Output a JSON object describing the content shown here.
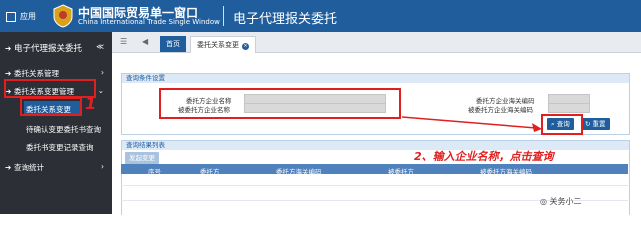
{
  "topbar": {
    "app_label": "应用",
    "brand_cn": "中国国际贸易单一窗口",
    "brand_en": "China International Trade Single Window",
    "title": "电子代理报关委托"
  },
  "sidebar": {
    "module_title": "电子代理报关委托",
    "items": [
      {
        "label": "委托关系管理"
      },
      {
        "label": "委托关系变更管理"
      },
      {
        "label": "委托关系变更"
      },
      {
        "label": "待确认变更委托书查询"
      },
      {
        "label": "委托书变更记录查询"
      },
      {
        "label": "查询统计"
      }
    ]
  },
  "tabs": {
    "home": "首页",
    "current": "委托关系变更"
  },
  "query": {
    "section_title": "查询条件设置",
    "principal_name_label": "委托方企业名称",
    "principal_code_label": "委托方企业海关编码",
    "agent_name_label": "被委托方企业名称",
    "agent_code_label": "被委托方企业海关编码",
    "search_btn": "查询",
    "reset_btn": "重置"
  },
  "results": {
    "section_title": "查询结果列表",
    "change_btn": "发起变更",
    "columns": [
      "序号",
      "委托方",
      "委托方海关编码",
      "被委托方",
      "被委托方海关编码"
    ]
  },
  "annotations": {
    "step1": "1",
    "step2": "2、输入企业名称，点击查询"
  },
  "watermark": "关务小二",
  "colors": {
    "brand_blue": "#1f5d9c",
    "annotation_red": "#e02020",
    "sidebar_dark": "#2c2f36"
  }
}
